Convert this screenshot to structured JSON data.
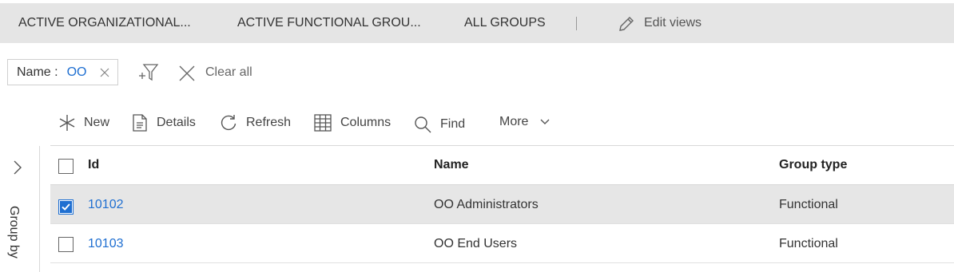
{
  "tabs": [
    {
      "label": "ACTIVE ORGANIZATIONAL..."
    },
    {
      "label": "ACTIVE FUNCTIONAL GROU..."
    },
    {
      "label": "ALL GROUPS"
    }
  ],
  "edit_views_label": "Edit views",
  "filter": {
    "key": "Name :",
    "value": "OO"
  },
  "clear_all_label": "Clear all",
  "toolbar": {
    "new_label": "New",
    "details_label": "Details",
    "refresh_label": "Refresh",
    "columns_label": "Columns",
    "find_label": "Find",
    "more_label": "More"
  },
  "group_by_label": "Group by",
  "table": {
    "columns": [
      "Id",
      "Name",
      "Group type"
    ],
    "rows": [
      {
        "id": "10102",
        "name": "OO Administrators",
        "type": "Functional",
        "checked": true
      },
      {
        "id": "10103",
        "name": "OO End Users",
        "type": "Functional",
        "checked": false
      }
    ]
  },
  "colors": {
    "accent": "#1f6fd1",
    "tabbar_bg": "#e5e5e5",
    "selected_row_bg": "#e6e6e6"
  }
}
